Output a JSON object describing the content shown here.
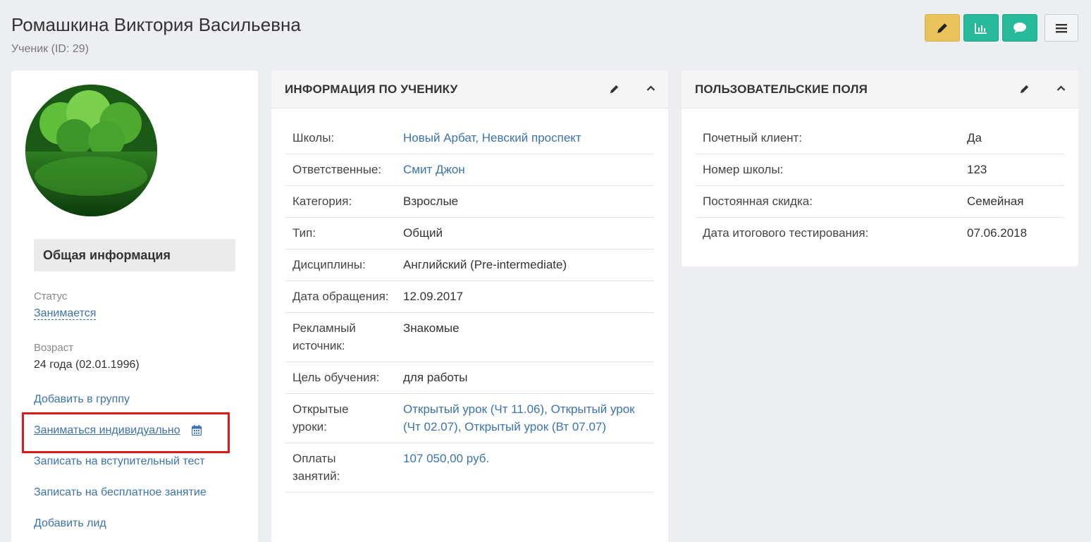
{
  "header": {
    "title": "Ромашкина Виктория Васильевна",
    "subtitle": "Ученик (ID: 29)"
  },
  "toolbar": {
    "edit_icon": "pencil-icon",
    "stats_icon": "bar-chart-icon",
    "chat_icon": "chat-bubble-icon",
    "menu_icon": "hamburger-menu-icon",
    "colors": {
      "edit": "#e9c35a",
      "stats": "#26b99a",
      "chat": "#26b99a"
    }
  },
  "left": {
    "general_title": "Общая информация",
    "status_label": "Статус",
    "status_value": "Занимается",
    "age_label": "Возраст",
    "age_value": "24 года (02.01.1996)",
    "actions": {
      "add_group": "Добавить в группу",
      "individual": "Заниматься индивидуально",
      "entrance_test": "Записать на вступительный тест",
      "free_lesson": "Записать на бесплатное занятие",
      "add_lead": "Добавить лид"
    }
  },
  "info_panel": {
    "title": "ИНФОРМАЦИЯ ПО УЧЕНИКУ",
    "rows": [
      {
        "label": "Школы:",
        "value": "Новый Арбат, Невский проспект"
      },
      {
        "label": "Ответственные:",
        "value": "Смит Джон"
      },
      {
        "label": "Категория:",
        "value": "Взрослые"
      },
      {
        "label": "Тип:",
        "value": "Общий"
      },
      {
        "label": "Дисциплины:",
        "value": "Английский (Pre-intermediate)"
      },
      {
        "label": "Дата обращения:",
        "value": "12.09.2017"
      },
      {
        "label": "Рекламный источник:",
        "value": "Знакомые"
      },
      {
        "label": "Цель обучения:",
        "value": "для работы"
      },
      {
        "label": "Открытые уроки:",
        "value": "Открытый урок (Чт 11.06), Открытый урок (Чт 02.07), Открытый урок (Вт 07.07)"
      },
      {
        "label": "Оплаты занятий:",
        "value": "107 050,00 руб."
      }
    ],
    "schools": [
      "Новый Арбат",
      "Невский проспект"
    ]
  },
  "custom_panel": {
    "title": "ПОЛЬЗОВАТЕЛЬСКИЕ ПОЛЯ",
    "rows": [
      {
        "label": "Почетный клиент:",
        "value": "Да"
      },
      {
        "label": "Номер школы:",
        "value": "123"
      },
      {
        "label": "Постоянная скидка:",
        "value": "Семейная"
      },
      {
        "label": "Дата итогового тестирования:",
        "value": "07.06.2018"
      }
    ]
  }
}
